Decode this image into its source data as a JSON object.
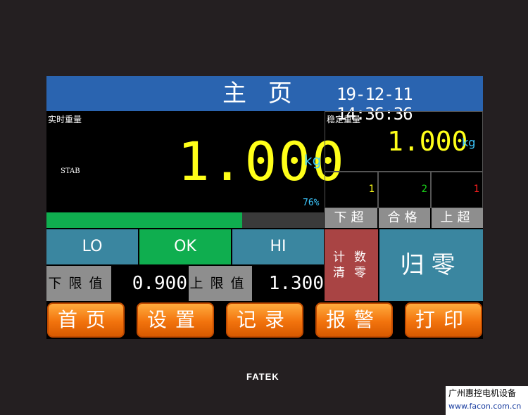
{
  "header": {
    "title": "主 页",
    "datetime": "19-12-11 14:36:36"
  },
  "realtime": {
    "label": "实时重量",
    "weight": "1.000",
    "unit": "kg",
    "status": "STAB",
    "percent_text": "76%",
    "progress_fraction": 0.76
  },
  "stable": {
    "label": "稳定重量",
    "weight": "1.000",
    "unit": "kg"
  },
  "counts": [
    {
      "value": "1",
      "color": "#ffff19",
      "label": "下超"
    },
    {
      "value": "2",
      "color": "#19d219",
      "label": "合格"
    },
    {
      "value": "1",
      "color": "#ff1e1e",
      "label": "上超"
    }
  ],
  "result": {
    "lo": "LO",
    "ok": "OK",
    "hi": "HI",
    "lo_color": "#3a86a0",
    "ok_color": "#0fae4f",
    "hi_color": "#3a86a0"
  },
  "limits": {
    "lower_label": "下限值",
    "lower_value": "0.900",
    "upper_label": "上限值",
    "upper_value": "1.300"
  },
  "buttons": {
    "clear_count": [
      "计",
      "数",
      "清",
      "零"
    ],
    "zero": "归零"
  },
  "nav": [
    {
      "label": "首页"
    },
    {
      "label": "设置"
    },
    {
      "label": "记录"
    },
    {
      "label": "报警"
    },
    {
      "label": "打印"
    }
  ],
  "device": {
    "brand": "FATEK"
  },
  "watermark": {
    "company": "广州惠控电机设备",
    "url": "www.facon.com.cn"
  }
}
